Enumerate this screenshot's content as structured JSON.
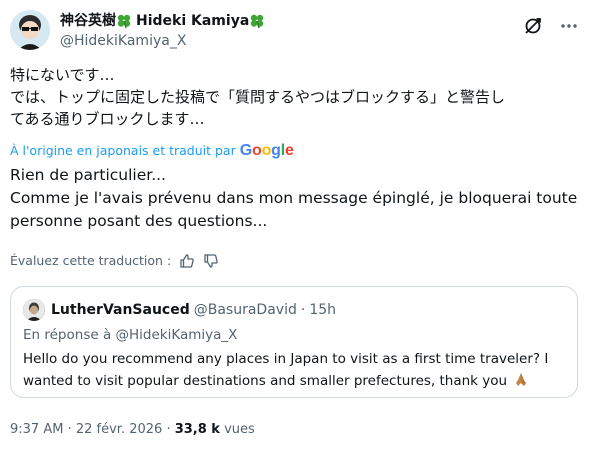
{
  "author": {
    "name_jp": "神谷英樹",
    "name_en": "Hideki Kamiya",
    "handle": "@HidekiKamiya_X"
  },
  "post": {
    "jp_lines": [
      "特にないです…",
      "では、トップに固定した投稿で「質問するやつはブロックする」と警告し",
      "てある通りブロックします…"
    ],
    "translated_note": "À l'origine en japonais et traduit par",
    "translator": "Google",
    "fr_lines": [
      "Rien de particulier...",
      "Comme je l'avais prévenu dans mon message épinglé, je bloquerai toute",
      "personne posant des questions..."
    ],
    "rate_label": "Évaluez cette traduction :"
  },
  "quote": {
    "name": "LutherVanSauced",
    "handle": "@BasuraDavid",
    "time": "15h",
    "reply_prefix": "En réponse à",
    "reply_handle": "@HidekiKamiya_X",
    "body_lines": [
      "Hello do you recommend any places in Japan to visit as a first time traveler? I",
      "wanted to visit popular destinations and smaller prefectures, thank you"
    ]
  },
  "meta": {
    "time": "9:37 AM",
    "date": "22 févr. 2026",
    "views": "33,8 k",
    "views_label": "vues"
  },
  "colors": {
    "accent": "#1d9bf0",
    "secondary_text": "#536471",
    "border": "#cfd9de",
    "clover": "#3fa535"
  },
  "icons": [
    "clover-icon",
    "grok-icon",
    "more-icon",
    "thumbs-up-icon",
    "thumbs-down-icon",
    "folded-hands-emoji"
  ]
}
